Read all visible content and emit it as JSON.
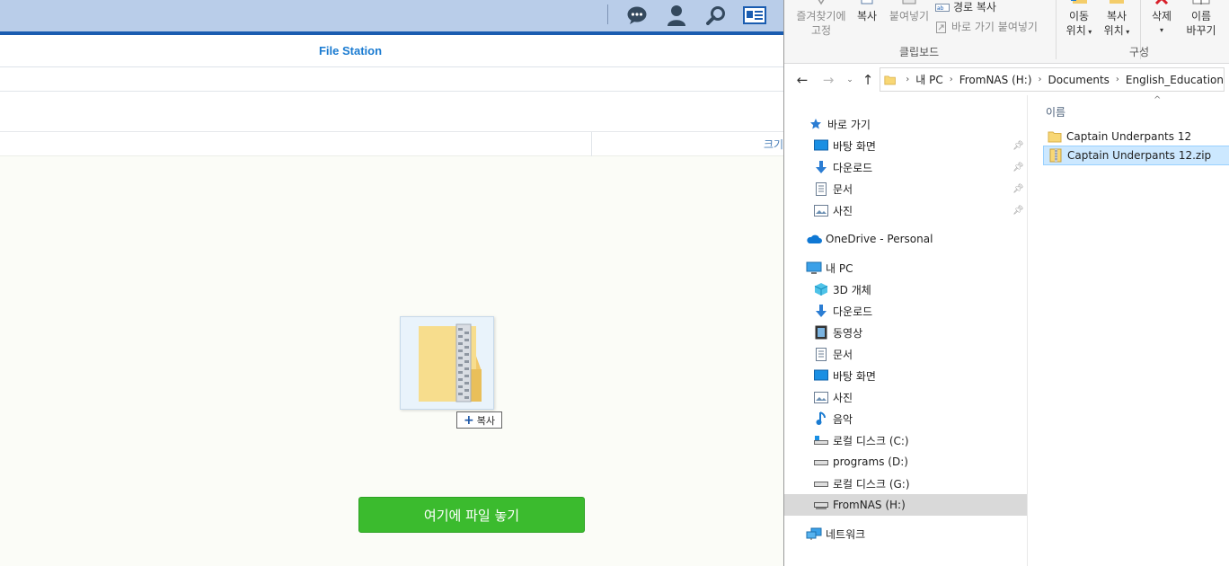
{
  "file_station": {
    "title": "File Station",
    "column_size": "크기",
    "copy_badge": "복사",
    "drop_button": "여기에 파일 놓기",
    "top_icons": [
      "chat-icon",
      "user-icon",
      "search-icon",
      "widget-icon"
    ]
  },
  "explorer": {
    "ribbon": {
      "pin_quick_access": [
        "즐겨찾기에",
        "고정"
      ],
      "copy": "복사",
      "paste": "붙여넣기",
      "copy_path": "경로 복사",
      "paste_shortcut": "바로 가기 붙여넣기",
      "clipboard_group": "클립보드",
      "move_to": [
        "이동",
        "위치"
      ],
      "copy_to": [
        "복사",
        "위치"
      ],
      "delete": "삭제",
      "rename": [
        "이름",
        "바꾸기"
      ],
      "organize_group": "구성"
    },
    "address": [
      "내 PC",
      "FromNAS (H:)",
      "Documents",
      "English_Education"
    ],
    "nav": [
      {
        "label": "바로 가기",
        "icon": "star-icon"
      },
      {
        "label": "바탕 화면",
        "icon": "desktop-icon",
        "pinned": true
      },
      {
        "label": "다운로드",
        "icon": "download-icon",
        "pinned": true
      },
      {
        "label": "문서",
        "icon": "document-icon",
        "pinned": true
      },
      {
        "label": "사진",
        "icon": "pictures-icon",
        "pinned": true
      },
      {
        "label": "OneDrive - Personal",
        "icon": "cloud-icon"
      },
      {
        "label": "내 PC",
        "icon": "computer-icon"
      },
      {
        "label": "3D 개체",
        "icon": "cube-icon"
      },
      {
        "label": "다운로드",
        "icon": "download-icon"
      },
      {
        "label": "동영상",
        "icon": "video-icon"
      },
      {
        "label": "문서",
        "icon": "document-icon"
      },
      {
        "label": "바탕 화면",
        "icon": "desktop-icon"
      },
      {
        "label": "사진",
        "icon": "pictures-icon"
      },
      {
        "label": "음악",
        "icon": "music-icon"
      },
      {
        "label": "로컬 디스크 (C:)",
        "icon": "drive-icon"
      },
      {
        "label": "programs (D:)",
        "icon": "drive-icon"
      },
      {
        "label": "로컬 디스크 (G:)",
        "icon": "drive-icon"
      },
      {
        "label": "FromNAS (H:)",
        "icon": "network-drive-icon",
        "selected": true
      },
      {
        "label": "네트워크",
        "icon": "network-icon"
      }
    ],
    "column_name": "이름",
    "files": [
      {
        "name": "Captain Underpants 12",
        "type": "folder"
      },
      {
        "name": "Captain Underpants 12.zip",
        "type": "zip",
        "selected": true
      }
    ]
  },
  "colors": {
    "accent": "#1a7bd1",
    "drop_button": "#3bbb2e",
    "selection": "#cce8ff"
  }
}
